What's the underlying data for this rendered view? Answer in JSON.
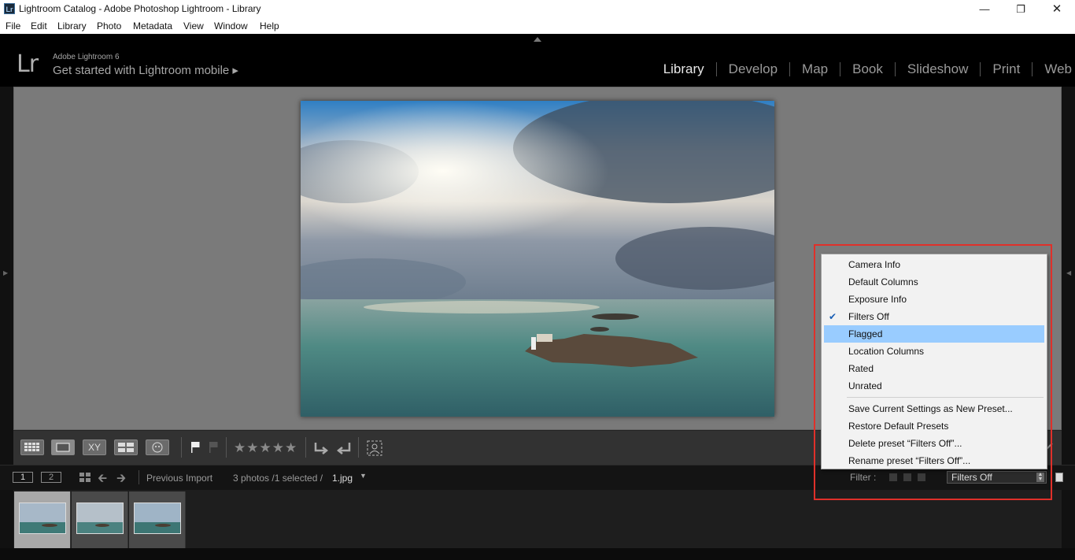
{
  "window": {
    "title": "Lightroom Catalog - Adobe Photoshop Lightroom - Library",
    "app_icon": "Lr",
    "controls": [
      "minimize-icon",
      "restore-icon",
      "close-icon"
    ]
  },
  "menu": [
    "File",
    "Edit",
    "Library",
    "Photo",
    "Metadata",
    "View",
    "Window",
    "Help"
  ],
  "identity": {
    "logo": "Lr",
    "version": "Adobe Lightroom 6",
    "mobile": "Get started with Lightroom mobile ▸"
  },
  "modules": [
    {
      "label": "Library",
      "active": true
    },
    {
      "label": "Develop",
      "active": false
    },
    {
      "label": "Map",
      "active": false
    },
    {
      "label": "Book",
      "active": false
    },
    {
      "label": "Slideshow",
      "active": false
    },
    {
      "label": "Print",
      "active": false
    },
    {
      "label": "Web",
      "active": false
    }
  ],
  "toolbar": {
    "view_buttons": [
      "grid-view-icon",
      "loupe-view-icon",
      "compare-view-icon",
      "survey-view-icon",
      "people-view-icon"
    ],
    "compare_label": "XY",
    "rating": "★★★★★"
  },
  "filmstrip_header": {
    "screen1": "1",
    "screen2": "2",
    "source": "Previous Import",
    "count": "3 photos /1 selected /",
    "filename": "1.jpg",
    "filter_label": "Filter :",
    "filter_value": "Filters Off"
  },
  "filmstrip": {
    "thumbnails": [
      {
        "selected": true
      },
      {
        "selected": false
      },
      {
        "selected": false
      }
    ]
  },
  "context_menu": {
    "group1": [
      {
        "label": "Camera Info",
        "checked": false,
        "highlighted": false
      },
      {
        "label": "Default Columns",
        "checked": false,
        "highlighted": false
      },
      {
        "label": "Exposure Info",
        "checked": false,
        "highlighted": false
      },
      {
        "label": "Filters Off",
        "checked": true,
        "highlighted": false
      },
      {
        "label": "Flagged",
        "checked": false,
        "highlighted": true
      },
      {
        "label": "Location Columns",
        "checked": false,
        "highlighted": false
      },
      {
        "label": "Rated",
        "checked": false,
        "highlighted": false
      },
      {
        "label": "Unrated",
        "checked": false,
        "highlighted": false
      }
    ],
    "group2": [
      {
        "label": "Save Current Settings as New Preset..."
      },
      {
        "label": "Restore Default Presets"
      },
      {
        "label": "Delete preset “Filters Off”..."
      },
      {
        "label": "Rename preset “Filters Off”..."
      }
    ]
  },
  "colors": {
    "highlight": "#99ccff",
    "annotation": "#e0302a",
    "viewer_bg": "#7a7a7a"
  }
}
